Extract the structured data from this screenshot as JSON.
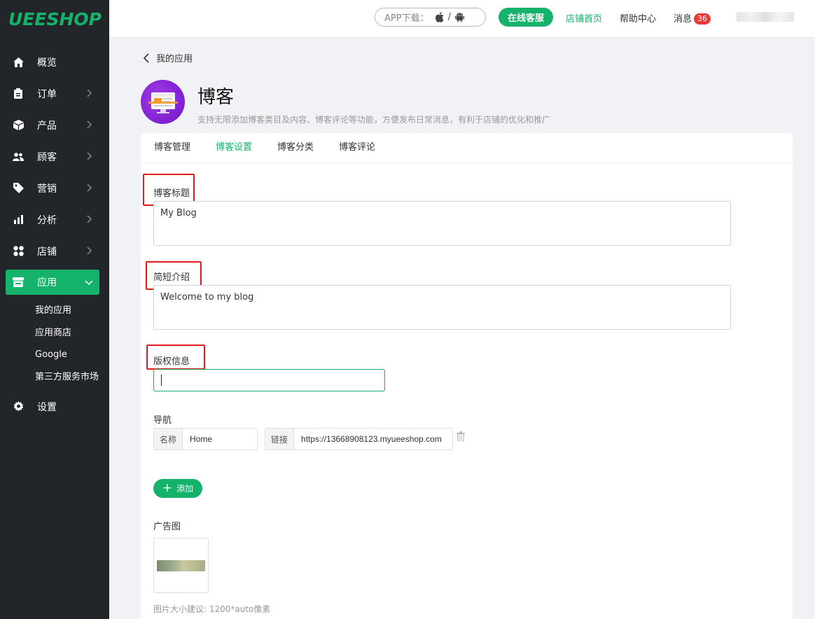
{
  "brand": {
    "logo": "UEESHOP"
  },
  "sidebar": {
    "items": [
      {
        "label": "概览",
        "icon": "home-icon"
      },
      {
        "label": "订单",
        "icon": "clipboard-icon"
      },
      {
        "label": "产品",
        "icon": "box-icon"
      },
      {
        "label": "顾客",
        "icon": "users-icon"
      },
      {
        "label": "营销",
        "icon": "tag-icon"
      },
      {
        "label": "分析",
        "icon": "bar-chart-icon"
      },
      {
        "label": "店铺",
        "icon": "grid-icon"
      },
      {
        "label": "应用",
        "icon": "store-icon"
      }
    ],
    "subitems": [
      "我的应用",
      "应用商店",
      "Google",
      "第三方服务市场"
    ],
    "settings": {
      "label": "设置",
      "icon": "gear-icon"
    }
  },
  "topbar": {
    "app_download": "APP下载：",
    "app_sep": "/",
    "online_service": "在线客服",
    "store_home": "店铺首页",
    "help_center": "帮助中心",
    "messages": "消息",
    "message_count": "36"
  },
  "header": {
    "back_label": "我的应用",
    "title": "博客",
    "description": "支持无限添加博客类目及内容、博客评论等功能，方便发布日常消息，有利于店铺的优化和推广"
  },
  "tabs": [
    "博客管理",
    "博客设置",
    "博客分类",
    "博客评论"
  ],
  "form": {
    "blog_title_label": "博客标题",
    "blog_title_value": "My Blog",
    "intro_label": "简短介绍",
    "intro_value": "Welcome to my blog",
    "copyright_label": "版权信息",
    "copyright_value": "",
    "nav_label": "导航",
    "nav_name_addon": "名称",
    "nav_name_value": "Home",
    "nav_link_addon": "链接",
    "nav_link_value": "https://13668908123.myueeshop.com",
    "add_label": "添加",
    "ad_image_label": "广告图",
    "ad_image_hint": "图片大小建议: 1200*auto像素"
  },
  "colors": {
    "accent": "#14b26a",
    "sidebar_bg": "#22262b",
    "highlight": "#e51b1b",
    "badge": "#e93a3a"
  }
}
